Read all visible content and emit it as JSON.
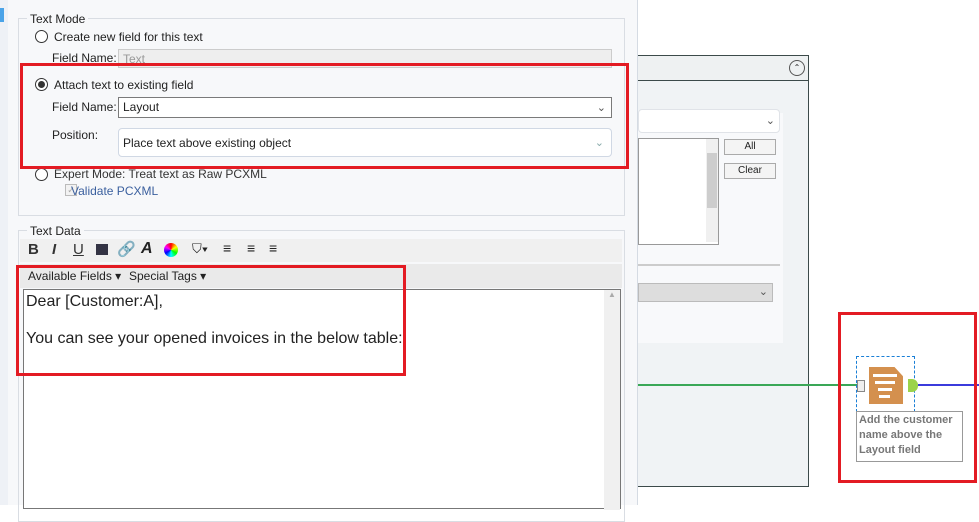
{
  "text_mode": {
    "title": "Text Mode",
    "create_new_label": "Create new field for this text",
    "field_name_label": "Field Name:",
    "field_name_value": "Text",
    "attach_label": "Attach text to existing field",
    "attach_field_label": "Field Name:",
    "attach_field_value": "Layout",
    "position_label": "Position:",
    "position_value": "Place text above existing object",
    "expert_label": "Expert Mode: Treat text as Raw PCXML",
    "validate_label": "Validate PCXML"
  },
  "text_data": {
    "title": "Text Data",
    "toolbar": [
      "B",
      "I",
      "U"
    ],
    "available_fields": "Available Fields",
    "special_tags": "Special Tags",
    "line1": "Dear [Customer:A],",
    "line2": "You can see your opened invoices in the below table:"
  },
  "right_panel": {
    "all_button": "All",
    "clear_button": "Clear"
  },
  "canvas": {
    "tool_annotation": "Add the customer name above the Layout field"
  },
  "colors": {
    "highlight": "#e31b23",
    "tool": "#d4904e",
    "green_line": "#3aa757",
    "blue_line": "#3b3bdc"
  }
}
